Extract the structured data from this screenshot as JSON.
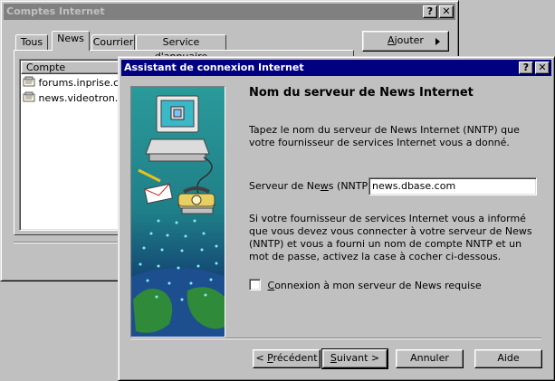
{
  "back_window": {
    "title": "Comptes Internet",
    "help_btn": "?",
    "close_btn": "✕",
    "tabs": [
      "Tous",
      "News",
      "Courrier",
      "Service d'annuaire"
    ],
    "list_header": "Compte",
    "accounts": [
      "forums.inprise.com",
      "news.videotron.ca"
    ],
    "add_button": "Ajouter",
    "add_button_accel": "A",
    "add_button_rest": "jouter"
  },
  "wizard": {
    "title": "Assistant de connexion Internet",
    "help_btn": "?",
    "close_btn": "✕",
    "heading": "Nom du serveur de News Internet",
    "intro": "Tapez le nom du serveur de News Internet (NNTP) que votre fournisseur de services Internet vous a donné.",
    "server_label_pre": "Serveur de Ne",
    "server_label_accel": "w",
    "server_label_post": "s (NNTP) :",
    "server_value": "news.dbase.com",
    "auth_text": "Si votre fournisseur de services Internet vous a informé que vous devez vous connecter à votre serveur de News (NNTP) et vous a fourni un nom de compte NNTP et un mot de passe, activez la case à cocher ci-dessous.",
    "login_checkbox_accel": "C",
    "login_checkbox_rest": "onnexion à mon serveur de News requise",
    "login_checked": false,
    "buttons": {
      "back_pre": "< ",
      "back_accel": "P",
      "back_rest": "récédent",
      "next_accel": "S",
      "next_rest": "uivant >",
      "cancel": "Annuler",
      "help": "Aide"
    }
  }
}
